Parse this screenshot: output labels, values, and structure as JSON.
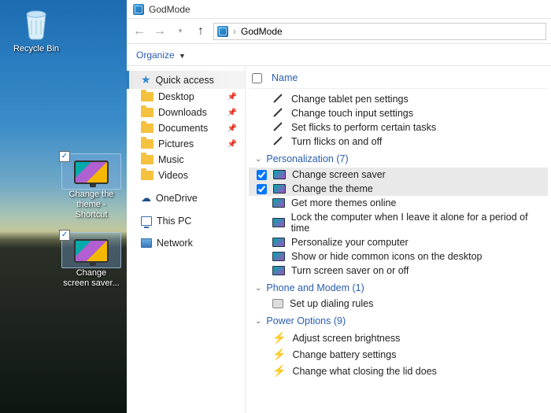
{
  "desktop": {
    "recycle_label": "Recycle Bin",
    "shortcut1_label": "Change the theme - Shortcut",
    "shortcut2_label": "Change screen saver..."
  },
  "window": {
    "title": "GodMode",
    "address": "GodMode",
    "organize_label": "Organize",
    "name_header": "Name"
  },
  "sidebar": {
    "quick_access": "Quick access",
    "items": [
      {
        "label": "Desktop"
      },
      {
        "label": "Downloads"
      },
      {
        "label": "Documents"
      },
      {
        "label": "Pictures"
      },
      {
        "label": "Music"
      },
      {
        "label": "Videos"
      }
    ],
    "onedrive": "OneDrive",
    "this_pc": "This PC",
    "network": "Network"
  },
  "groups": {
    "pen": [
      "Change tablet pen settings",
      "Change touch input settings",
      "Set flicks to perform certain tasks",
      "Turn flicks on and off"
    ],
    "personalization_header": "Personalization (7)",
    "personalization": [
      "Change screen saver",
      "Change the theme",
      "Get more themes online",
      "Lock the computer when I leave it alone for a period of time",
      "Personalize your computer",
      "Show or hide common icons on the desktop",
      "Turn screen saver on or off"
    ],
    "phone_header": "Phone and Modem (1)",
    "phone": [
      "Set up dialing rules"
    ],
    "power_header": "Power Options (9)",
    "power": [
      "Adjust screen brightness",
      "Change battery settings",
      "Change what closing the lid does"
    ]
  }
}
